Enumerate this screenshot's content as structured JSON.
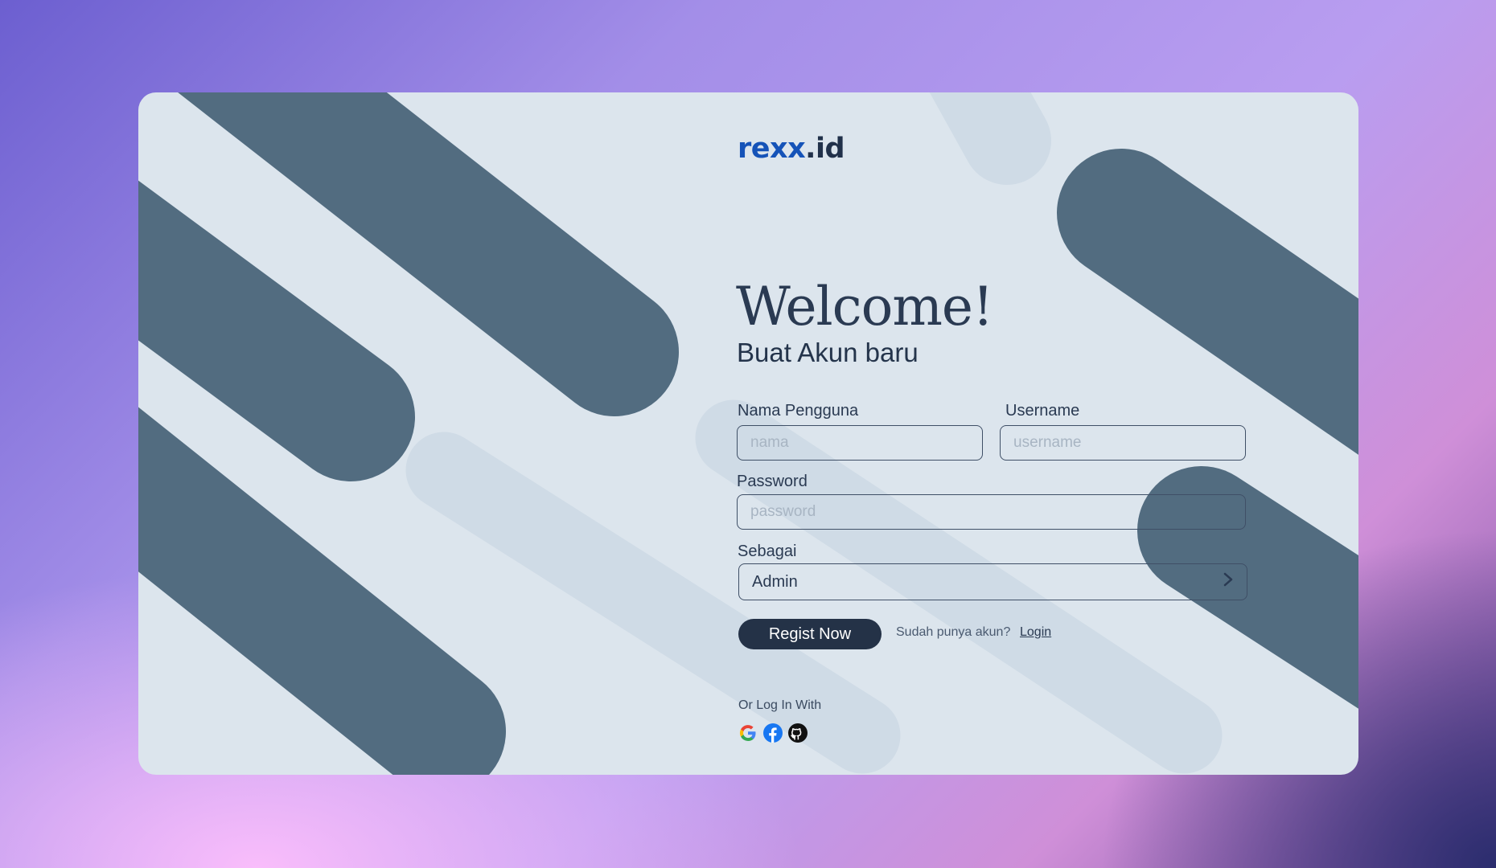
{
  "brand": {
    "part1": "rexx",
    "part2": ".id"
  },
  "heading": {
    "title": "Welcome!",
    "subtitle": "Buat Akun baru"
  },
  "form": {
    "name_label": "Nama Pengguna",
    "name_placeholder": "nama",
    "username_label": "Username",
    "username_placeholder": "username",
    "password_label": "Password",
    "password_placeholder": "password",
    "role_label": "Sebagai",
    "role_value": "Admin",
    "submit_label": "Regist Now"
  },
  "login_prompt": {
    "question": "Sudah punya akun?",
    "link": "Login"
  },
  "social": {
    "label": "Or Log In With",
    "providers": [
      "google-icon",
      "facebook-icon",
      "github-icon"
    ]
  },
  "colors": {
    "primary_dark": "#243247",
    "brand_blue": "#1553b8",
    "card_bg": "#dce5ed",
    "stripe_dark": "#526c80",
    "stripe_light": "#cfdbe6"
  }
}
